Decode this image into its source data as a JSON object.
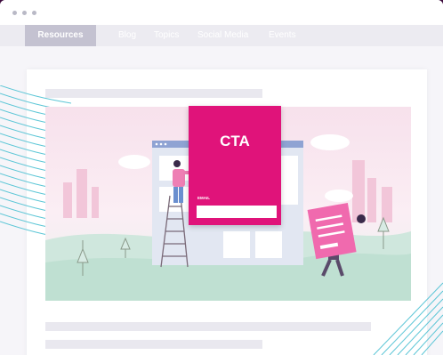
{
  "window": {
    "controls": [
      "dot",
      "dot",
      "dot"
    ]
  },
  "nav": {
    "items": [
      {
        "label": "Resources",
        "active": true
      },
      {
        "label": "Blog",
        "active": false
      },
      {
        "label": "Topics",
        "active": false
      },
      {
        "label": "Social Media",
        "active": false
      },
      {
        "label": "Events",
        "active": false
      }
    ]
  },
  "cta": {
    "title": "CTA",
    "email_label": "EMAIL"
  },
  "colors": {
    "frame": "#3d0a3d",
    "accent": "#e0137a",
    "teal_lines": "#5cc6d6",
    "nav_bg": "#ecebf1"
  },
  "icons": [
    "illustration-hero",
    "person-on-ladder",
    "person-holding-form",
    "browser-mockup"
  ]
}
